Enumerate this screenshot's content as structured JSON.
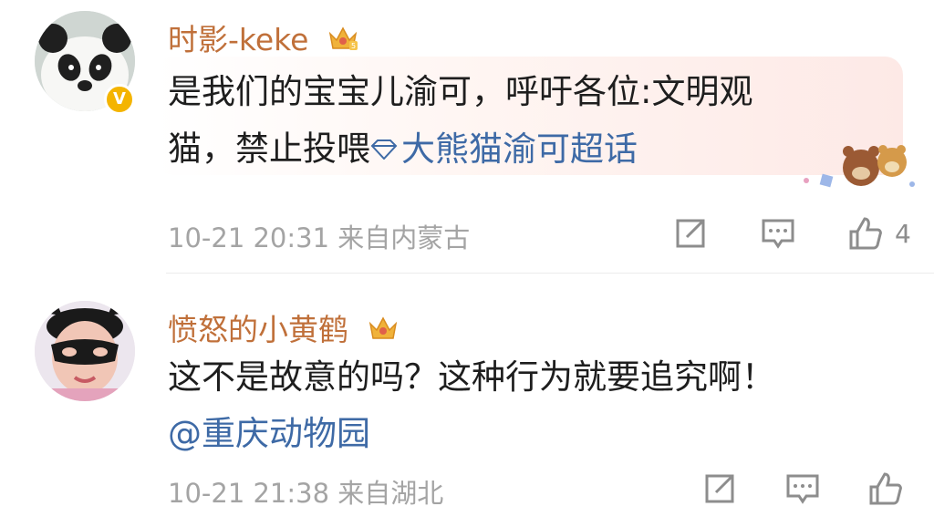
{
  "comments": [
    {
      "username": "时影-keke",
      "text_line1": "是我们的宝宝儿渝可，呼吁各位:文明观",
      "text_line2_prefix": "猫，禁止投喂",
      "topic": "大熊猫渝可超话",
      "time": "10-21 20:31",
      "location": "来自内蒙古",
      "like_count": "4",
      "colors": {
        "username": "#c0703a",
        "link": "#3e6aa6",
        "verified": "#f4b400"
      }
    },
    {
      "username": "愤怒的小黄鹤",
      "text_line1": "这不是故意的吗？这种行为就要追究啊！",
      "mention": "@重庆动物园",
      "time": "10-21 21:38",
      "location": "来自湖北"
    }
  ],
  "icons": {
    "verified_badge": "V",
    "actions": [
      "repost-icon",
      "comment-icon",
      "like-icon"
    ]
  }
}
